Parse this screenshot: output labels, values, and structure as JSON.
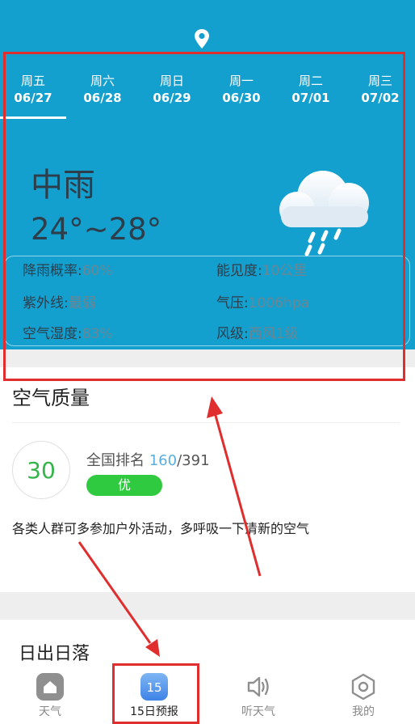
{
  "header": {
    "location_icon": "location-pin-icon"
  },
  "tabs": [
    {
      "weekday": "周五",
      "date": "06/27"
    },
    {
      "weekday": "周六",
      "date": "06/28"
    },
    {
      "weekday": "周日",
      "date": "06/29"
    },
    {
      "weekday": "周一",
      "date": "06/30"
    },
    {
      "weekday": "周二",
      "date": "07/01"
    },
    {
      "weekday": "周三",
      "date": "07/02"
    }
  ],
  "current": {
    "condition": "中雨",
    "temperature": "24°~28°",
    "icon": "rain-cloud-icon"
  },
  "details": {
    "rain_label": "降雨概率:",
    "rain_value": "60%",
    "visibility_label": "能见度:",
    "visibility_value": "10公里",
    "uv_label": "紫外线:",
    "uv_value": "最弱",
    "pressure_label": "气压:",
    "pressure_value": "1006hpa",
    "humidity_label": "空气湿度:",
    "humidity_value": "83%",
    "wind_label": "风级:",
    "wind_value": "西风1级"
  },
  "air_quality": {
    "title": "空气质量",
    "aqi": "30",
    "rank_label": "全国排名",
    "rank": "160",
    "total": "/391",
    "level": "优",
    "description": "各类人群可多参加户外活动，多呼吸一下清新的空气"
  },
  "sunrise": {
    "title": "日出日落"
  },
  "bottom_nav": [
    {
      "label": "天气",
      "icon": "home-icon"
    },
    {
      "label": "15日预报",
      "icon": "calendar-15-icon",
      "badge": "15"
    },
    {
      "label": "听天气",
      "icon": "speaker-icon"
    },
    {
      "label": "我的",
      "icon": "settings-hexagon-icon"
    }
  ],
  "colors": {
    "hero_bg": "#14a0cf",
    "aqi_green": "#2fca3f",
    "annotation_red": "#e02d2d"
  }
}
